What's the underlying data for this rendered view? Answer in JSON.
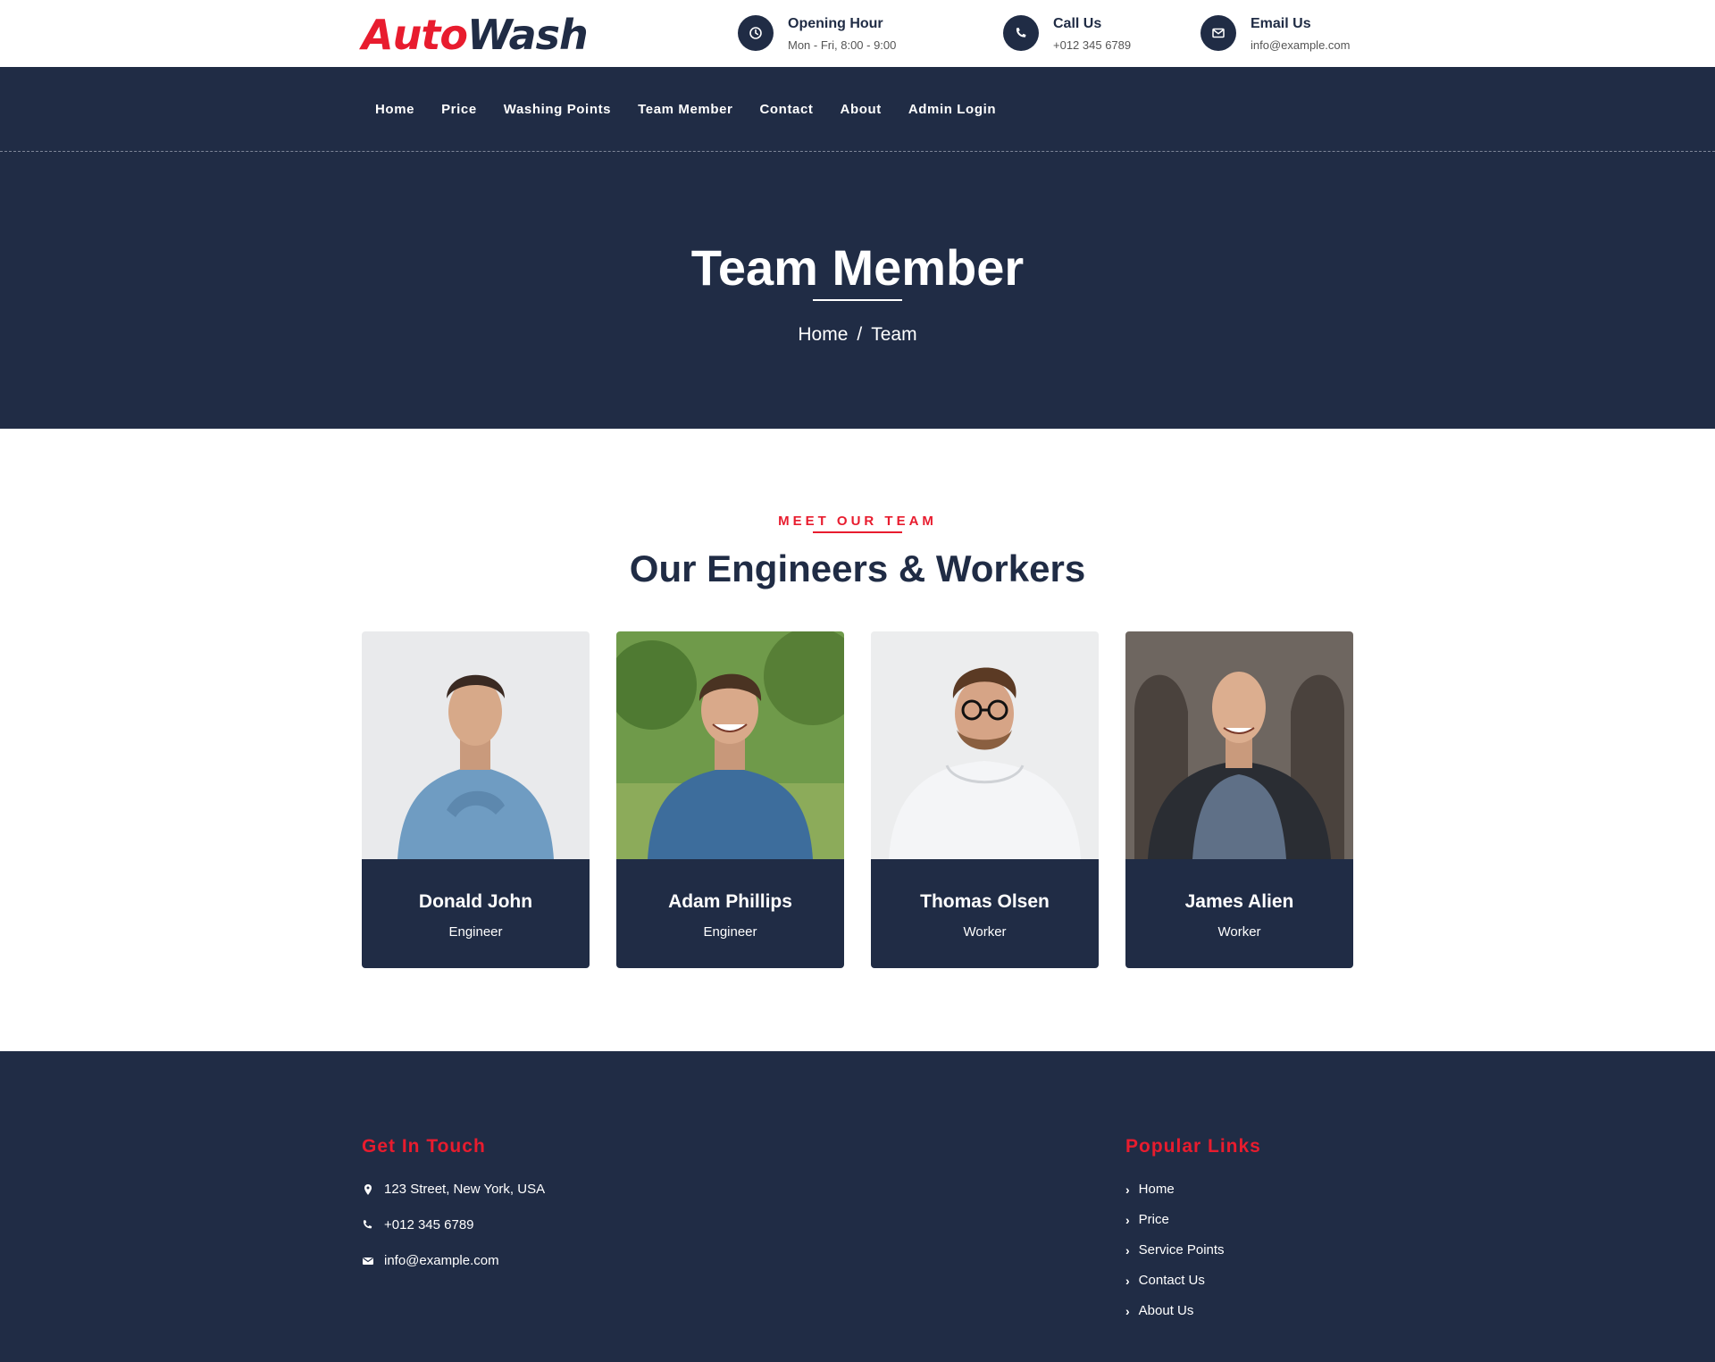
{
  "brand": {
    "part1": "Auto",
    "part2": "Wash"
  },
  "topinfo": [
    {
      "icon": "clock-icon",
      "title": "Opening Hour",
      "sub": "Mon - Fri, 8:00 - 9:00"
    },
    {
      "icon": "phone-icon",
      "title": "Call Us",
      "sub": "+012 345 6789"
    },
    {
      "icon": "envelope-icon",
      "title": "Email Us",
      "sub": "info@example.com"
    }
  ],
  "nav": [
    "Home",
    "Price",
    "Washing Points",
    "Team Member",
    "Contact",
    "About",
    "Admin Login"
  ],
  "header": {
    "title": "Team Member",
    "crumb_home": "Home",
    "crumb_sep": "/",
    "crumb_current": "Team"
  },
  "team": {
    "tag": "MEET OUR TEAM",
    "title": "Our Engineers & Workers",
    "members": [
      {
        "name": "Donald John",
        "role": "Engineer"
      },
      {
        "name": "Adam Phillips",
        "role": "Engineer"
      },
      {
        "name": "Thomas Olsen",
        "role": "Worker"
      },
      {
        "name": "James Alien",
        "role": "Worker"
      }
    ]
  },
  "footer": {
    "contact_heading": "Get In Touch",
    "address": "123 Street, New York, USA",
    "phone": "+012 345 6789",
    "email": "info@example.com",
    "links_heading": "Popular Links",
    "links": [
      "Home",
      "Price",
      "Service Points",
      "Contact Us",
      "About Us"
    ]
  },
  "colors": {
    "navy": "#202c45",
    "accent": "#e81c2e"
  }
}
